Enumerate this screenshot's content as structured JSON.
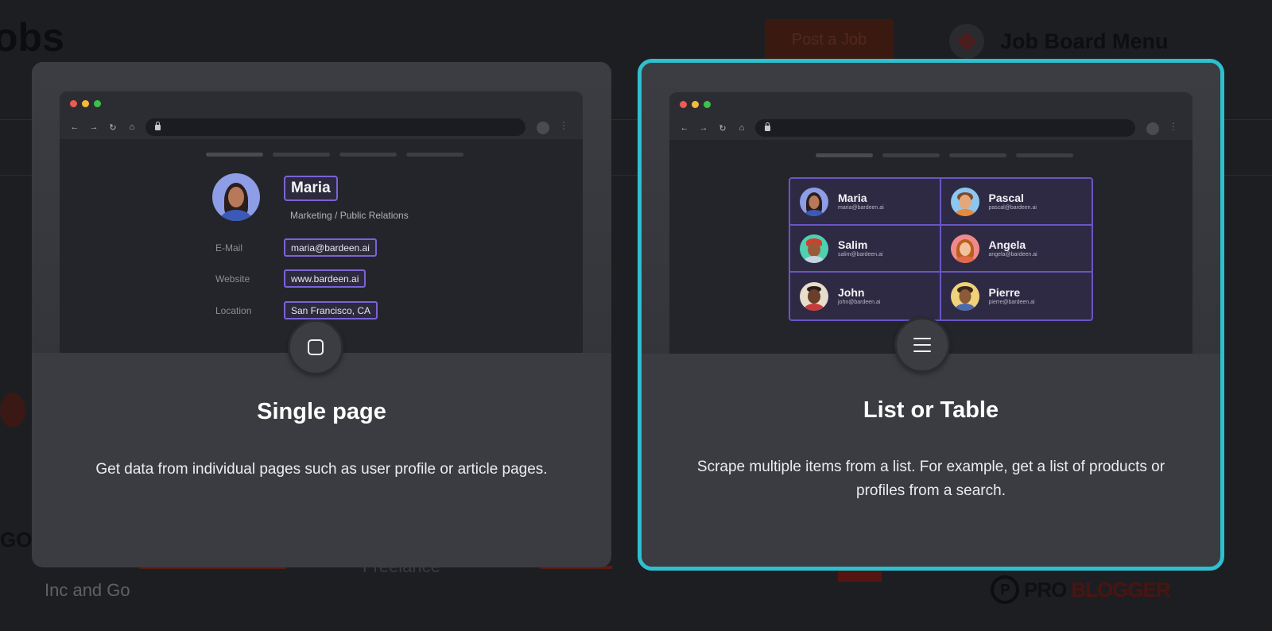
{
  "background": {
    "title_fragment": "obs",
    "post_job_label": "Post a Job",
    "menu_label": "Job Board Menu",
    "caption_left": "Inc and Go",
    "caption_mid": "Freelance",
    "logo_part1": "PRO",
    "logo_part2": "BLOGGER",
    "logo_mark": "P"
  },
  "cards": {
    "single": {
      "title": "Single page",
      "description": "Get data from individual pages such as user profile or article pages.",
      "icon": "square-icon",
      "preview": {
        "name": "Maria",
        "subtitle": "Marketing / Public Relations",
        "fields": [
          {
            "label": "E-Mail",
            "value": "maria@bardeen.ai"
          },
          {
            "label": "Website",
            "value": "www.bardeen.ai"
          },
          {
            "label": "Location",
            "value": "San Francisco, CA"
          }
        ]
      }
    },
    "list": {
      "title": "List or Table",
      "description": "Scrape multiple items from a list. For example, get a list of products or profiles from a search.",
      "icon": "list-icon",
      "selected": true,
      "preview": {
        "people": [
          {
            "name": "Maria",
            "email": "maria@bardeen.ai"
          },
          {
            "name": "Pascal",
            "email": "pascal@bardeen.ai"
          },
          {
            "name": "Salim",
            "email": "salim@bardeen.ai"
          },
          {
            "name": "Angela",
            "email": "angela@bardeen.ai"
          },
          {
            "name": "John",
            "email": "john@bardeen.ai"
          },
          {
            "name": "Pierre",
            "email": "pierre@bardeen.ai"
          }
        ]
      }
    }
  },
  "colors": {
    "selected_border": "#2ec0cf",
    "card_bg": "#3b3c41",
    "highlight_purple": "#7b63d6"
  }
}
